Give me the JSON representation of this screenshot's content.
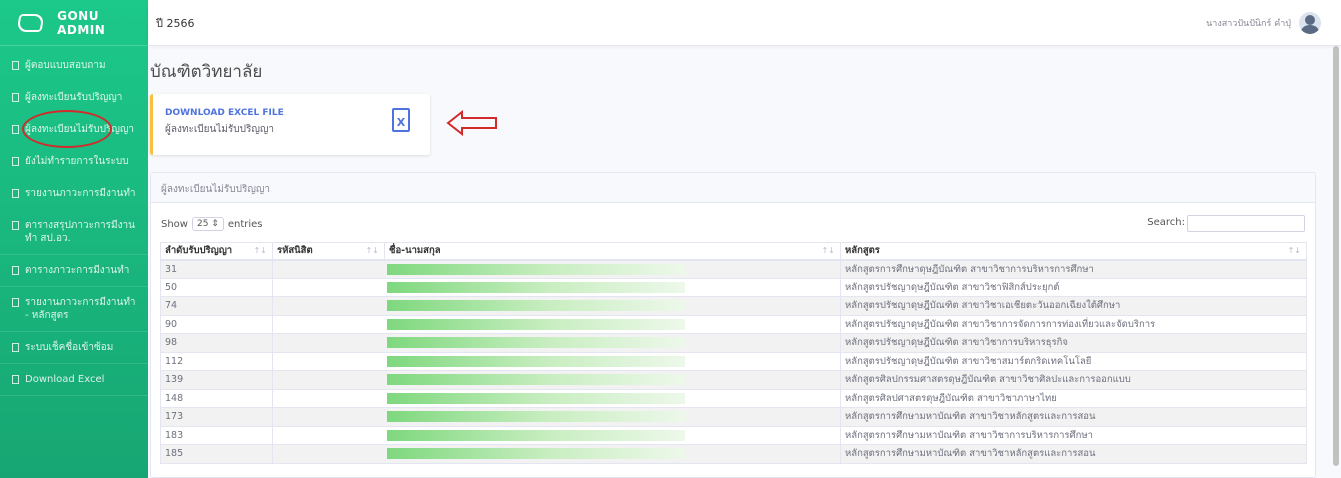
{
  "sidebar": {
    "brand": "GONU ADMIN",
    "items": [
      {
        "label": "ผู้ตอบแบบสอบถาม"
      },
      {
        "label": "ผู้ลงทะเบียนรับปริญญา"
      },
      {
        "label": "ผู้ลงทะเบียนไม่รับปริญญา"
      },
      {
        "label": "ยังไม่ทำรายการในระบบ"
      },
      {
        "label": "รายงานภาวะการมีงานทำ"
      },
      {
        "label": "ตารางสรุปภาวะการมีงานทำ สป.อว."
      },
      {
        "label": "ตารางภาวะการมีงานทำ"
      },
      {
        "label": "รายงานภาวะการมีงานทำ - หลักสูตร"
      },
      {
        "label": "ระบบเช็คชื่อเข้าซ้อม"
      },
      {
        "label": "Download Excel"
      }
    ]
  },
  "topbar": {
    "year": "ปี 2566",
    "user_name": "นางสาวปันปันิกร์ คำปุ่"
  },
  "page_title": "บัณฑิตวิทยาลัย",
  "download_card": {
    "title": "DOWNLOAD EXCEL FILE",
    "subtitle": "ผู้ลงทะเบียนไม่รับปริญญา",
    "icon_letter": "X"
  },
  "table_card": {
    "header": "ผู้ลงทะเบียนไม่รับปริญญา",
    "show_label": "Show",
    "entries_value": "25",
    "entries_label": "entries",
    "search_label": "Search:",
    "columns": [
      "ลำดับรับปริญญา",
      "รหัสนิสิต",
      "ชื่อ-นามสกุล",
      "หลักสูตร"
    ],
    "rows": [
      {
        "no": "31",
        "program": "หลักสูตรการศึกษาดุษฎีบัณฑิต สาขาวิชาการบริหารการศึกษา"
      },
      {
        "no": "50",
        "program": "หลักสูตรปรัชญาดุษฎีบัณฑิต สาขาวิชาฟิสิกส์ประยุกต์"
      },
      {
        "no": "74",
        "program": "หลักสูตรปรัชญาดุษฎีบัณฑิต สาขาวิชาเอเชียตะวันออกเฉียงใต้ศึกษา"
      },
      {
        "no": "90",
        "program": "หลักสูตรปรัชญาดุษฎีบัณฑิต สาขาวิชาการจัดการการท่องเที่ยวและจัดบริการ"
      },
      {
        "no": "98",
        "program": "หลักสูตรปรัชญาดุษฎีบัณฑิต สาขาวิชาการบริหารธุรกิจ"
      },
      {
        "no": "112",
        "program": "หลักสูตรปรัชญาดุษฎีบัณฑิต สาขาวิชาสมาร์ตกริดเทคโนโลยี"
      },
      {
        "no": "139",
        "program": "หลักสูตรศิลปกรรมศาสตรดุษฎีบัณฑิต สาขาวิชาศิลปะและการออกแบบ"
      },
      {
        "no": "148",
        "program": "หลักสูตรศิลปศาสตรดุษฎีบัณฑิต สาขาวิชาภาษาไทย"
      },
      {
        "no": "173",
        "program": "หลักสูตรการศึกษามหาบัณฑิต สาขาวิชาหลักสูตรและการสอน"
      },
      {
        "no": "183",
        "program": "หลักสูตรการศึกษามหาบัณฑิต สาขาวิชาการบริหารการศึกษา"
      },
      {
        "no": "185",
        "program": "หลักสูตรการศึกษามหาบัณฑิต สาขาวิชาหลักสูตรและการสอน"
      }
    ]
  },
  "colors": {
    "sidebar": "#1cc88a",
    "accent": "#4e73df",
    "card_border": "#f6c23e",
    "annotation": "#d12b2b"
  }
}
